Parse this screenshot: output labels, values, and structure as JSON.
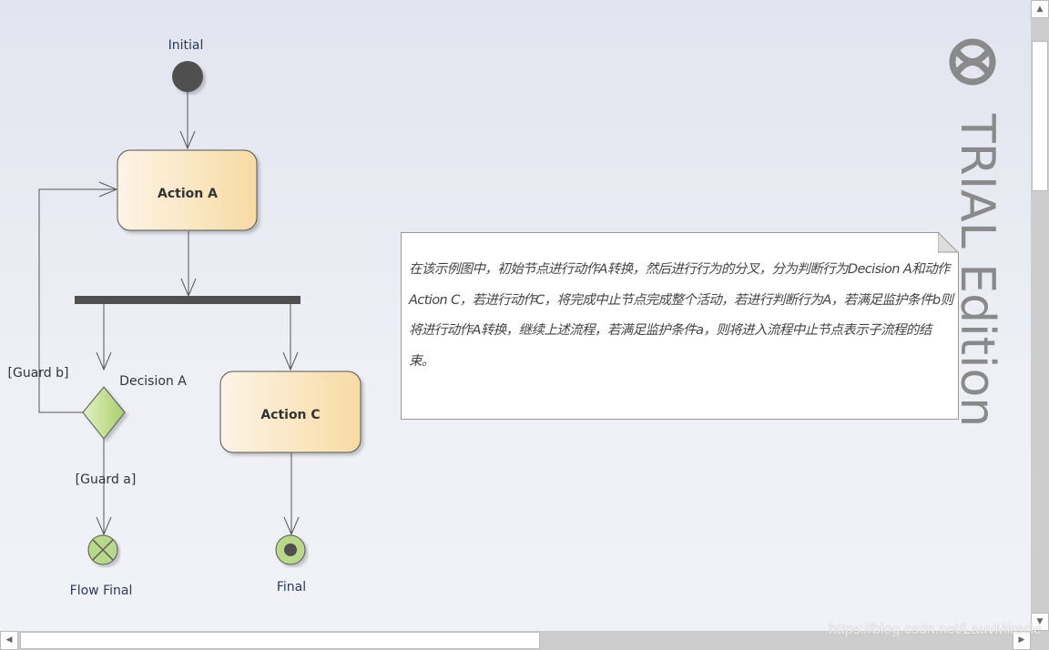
{
  "diagram": {
    "nodes": {
      "initial": "Initial",
      "action_a": "Action A",
      "action_c": "Action C",
      "decision_a": "Decision A",
      "flow_final": "Flow Final",
      "final": "Final"
    },
    "guards": {
      "guard_b": "[Guard b]",
      "guard_a": "[Guard a]"
    },
    "note": "在该示例图中，初始节点进行动作A转换，然后进行行为的分叉，分为判断行为Decision A和动作Action C，若进行动作C，将完成中止节点完成整个活动，若进行判断行为A，若满足监护条件b则将进行动作A转换，继续上述流程，若满足监护条件a，则将进入流程中止节点表示子流程的结束。"
  },
  "watermark": {
    "trial": "TRIAL Edition",
    "url": "https://blog.csdn.net/LauvMiracle"
  },
  "colors": {
    "action_fill_start": "#fdf3e3",
    "action_fill_end": "#f7dca6",
    "decision_fill": "#c2de8c",
    "node_dark": "#505050"
  }
}
